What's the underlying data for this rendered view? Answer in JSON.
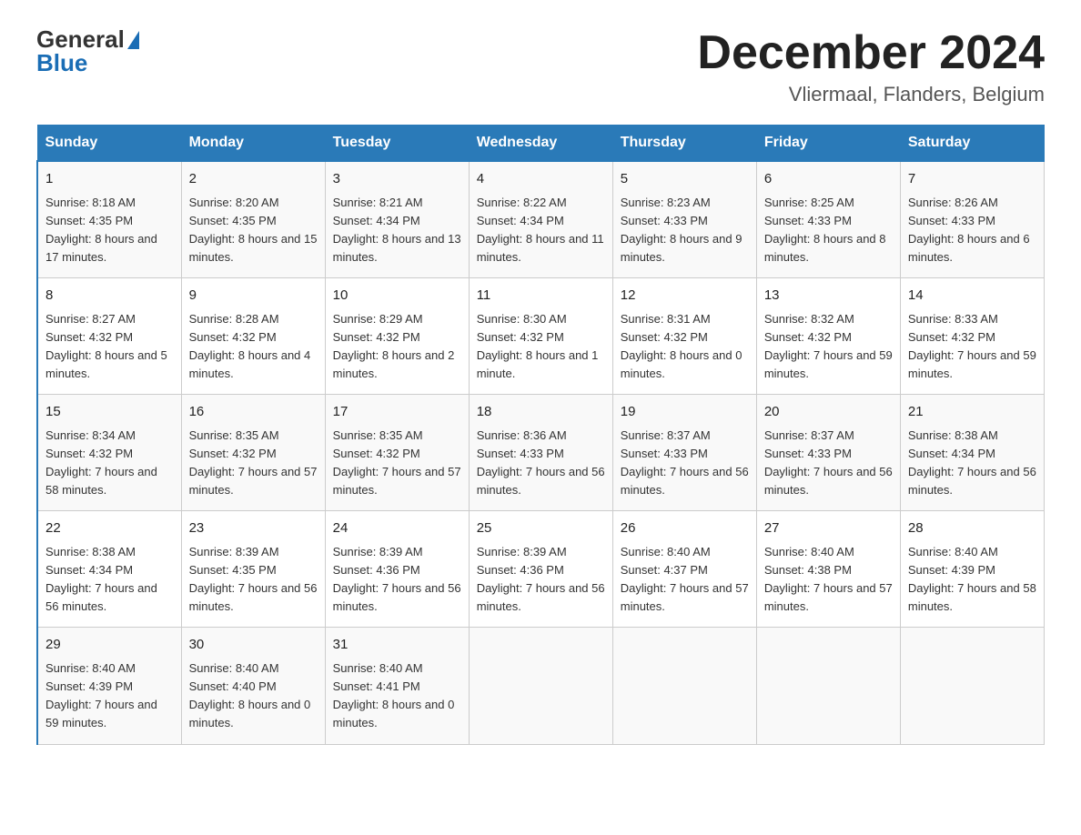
{
  "logo": {
    "text_general": "General",
    "text_blue": "Blue"
  },
  "title": "December 2024",
  "location": "Vliermaal, Flanders, Belgium",
  "days_of_week": [
    "Sunday",
    "Monday",
    "Tuesday",
    "Wednesday",
    "Thursday",
    "Friday",
    "Saturday"
  ],
  "weeks": [
    [
      {
        "day": "1",
        "sunrise": "8:18 AM",
        "sunset": "4:35 PM",
        "daylight": "8 hours and 17 minutes."
      },
      {
        "day": "2",
        "sunrise": "8:20 AM",
        "sunset": "4:35 PM",
        "daylight": "8 hours and 15 minutes."
      },
      {
        "day": "3",
        "sunrise": "8:21 AM",
        "sunset": "4:34 PM",
        "daylight": "8 hours and 13 minutes."
      },
      {
        "day": "4",
        "sunrise": "8:22 AM",
        "sunset": "4:34 PM",
        "daylight": "8 hours and 11 minutes."
      },
      {
        "day": "5",
        "sunrise": "8:23 AM",
        "sunset": "4:33 PM",
        "daylight": "8 hours and 9 minutes."
      },
      {
        "day": "6",
        "sunrise": "8:25 AM",
        "sunset": "4:33 PM",
        "daylight": "8 hours and 8 minutes."
      },
      {
        "day": "7",
        "sunrise": "8:26 AM",
        "sunset": "4:33 PM",
        "daylight": "8 hours and 6 minutes."
      }
    ],
    [
      {
        "day": "8",
        "sunrise": "8:27 AM",
        "sunset": "4:32 PM",
        "daylight": "8 hours and 5 minutes."
      },
      {
        "day": "9",
        "sunrise": "8:28 AM",
        "sunset": "4:32 PM",
        "daylight": "8 hours and 4 minutes."
      },
      {
        "day": "10",
        "sunrise": "8:29 AM",
        "sunset": "4:32 PM",
        "daylight": "8 hours and 2 minutes."
      },
      {
        "day": "11",
        "sunrise": "8:30 AM",
        "sunset": "4:32 PM",
        "daylight": "8 hours and 1 minute."
      },
      {
        "day": "12",
        "sunrise": "8:31 AM",
        "sunset": "4:32 PM",
        "daylight": "8 hours and 0 minutes."
      },
      {
        "day": "13",
        "sunrise": "8:32 AM",
        "sunset": "4:32 PM",
        "daylight": "7 hours and 59 minutes."
      },
      {
        "day": "14",
        "sunrise": "8:33 AM",
        "sunset": "4:32 PM",
        "daylight": "7 hours and 59 minutes."
      }
    ],
    [
      {
        "day": "15",
        "sunrise": "8:34 AM",
        "sunset": "4:32 PM",
        "daylight": "7 hours and 58 minutes."
      },
      {
        "day": "16",
        "sunrise": "8:35 AM",
        "sunset": "4:32 PM",
        "daylight": "7 hours and 57 minutes."
      },
      {
        "day": "17",
        "sunrise": "8:35 AM",
        "sunset": "4:32 PM",
        "daylight": "7 hours and 57 minutes."
      },
      {
        "day": "18",
        "sunrise": "8:36 AM",
        "sunset": "4:33 PM",
        "daylight": "7 hours and 56 minutes."
      },
      {
        "day": "19",
        "sunrise": "8:37 AM",
        "sunset": "4:33 PM",
        "daylight": "7 hours and 56 minutes."
      },
      {
        "day": "20",
        "sunrise": "8:37 AM",
        "sunset": "4:33 PM",
        "daylight": "7 hours and 56 minutes."
      },
      {
        "day": "21",
        "sunrise": "8:38 AM",
        "sunset": "4:34 PM",
        "daylight": "7 hours and 56 minutes."
      }
    ],
    [
      {
        "day": "22",
        "sunrise": "8:38 AM",
        "sunset": "4:34 PM",
        "daylight": "7 hours and 56 minutes."
      },
      {
        "day": "23",
        "sunrise": "8:39 AM",
        "sunset": "4:35 PM",
        "daylight": "7 hours and 56 minutes."
      },
      {
        "day": "24",
        "sunrise": "8:39 AM",
        "sunset": "4:36 PM",
        "daylight": "7 hours and 56 minutes."
      },
      {
        "day": "25",
        "sunrise": "8:39 AM",
        "sunset": "4:36 PM",
        "daylight": "7 hours and 56 minutes."
      },
      {
        "day": "26",
        "sunrise": "8:40 AM",
        "sunset": "4:37 PM",
        "daylight": "7 hours and 57 minutes."
      },
      {
        "day": "27",
        "sunrise": "8:40 AM",
        "sunset": "4:38 PM",
        "daylight": "7 hours and 57 minutes."
      },
      {
        "day": "28",
        "sunrise": "8:40 AM",
        "sunset": "4:39 PM",
        "daylight": "7 hours and 58 minutes."
      }
    ],
    [
      {
        "day": "29",
        "sunrise": "8:40 AM",
        "sunset": "4:39 PM",
        "daylight": "7 hours and 59 minutes."
      },
      {
        "day": "30",
        "sunrise": "8:40 AM",
        "sunset": "4:40 PM",
        "daylight": "8 hours and 0 minutes."
      },
      {
        "day": "31",
        "sunrise": "8:40 AM",
        "sunset": "4:41 PM",
        "daylight": "8 hours and 0 minutes."
      },
      {
        "day": "",
        "sunrise": "",
        "sunset": "",
        "daylight": ""
      },
      {
        "day": "",
        "sunrise": "",
        "sunset": "",
        "daylight": ""
      },
      {
        "day": "",
        "sunrise": "",
        "sunset": "",
        "daylight": ""
      },
      {
        "day": "",
        "sunrise": "",
        "sunset": "",
        "daylight": ""
      }
    ]
  ]
}
